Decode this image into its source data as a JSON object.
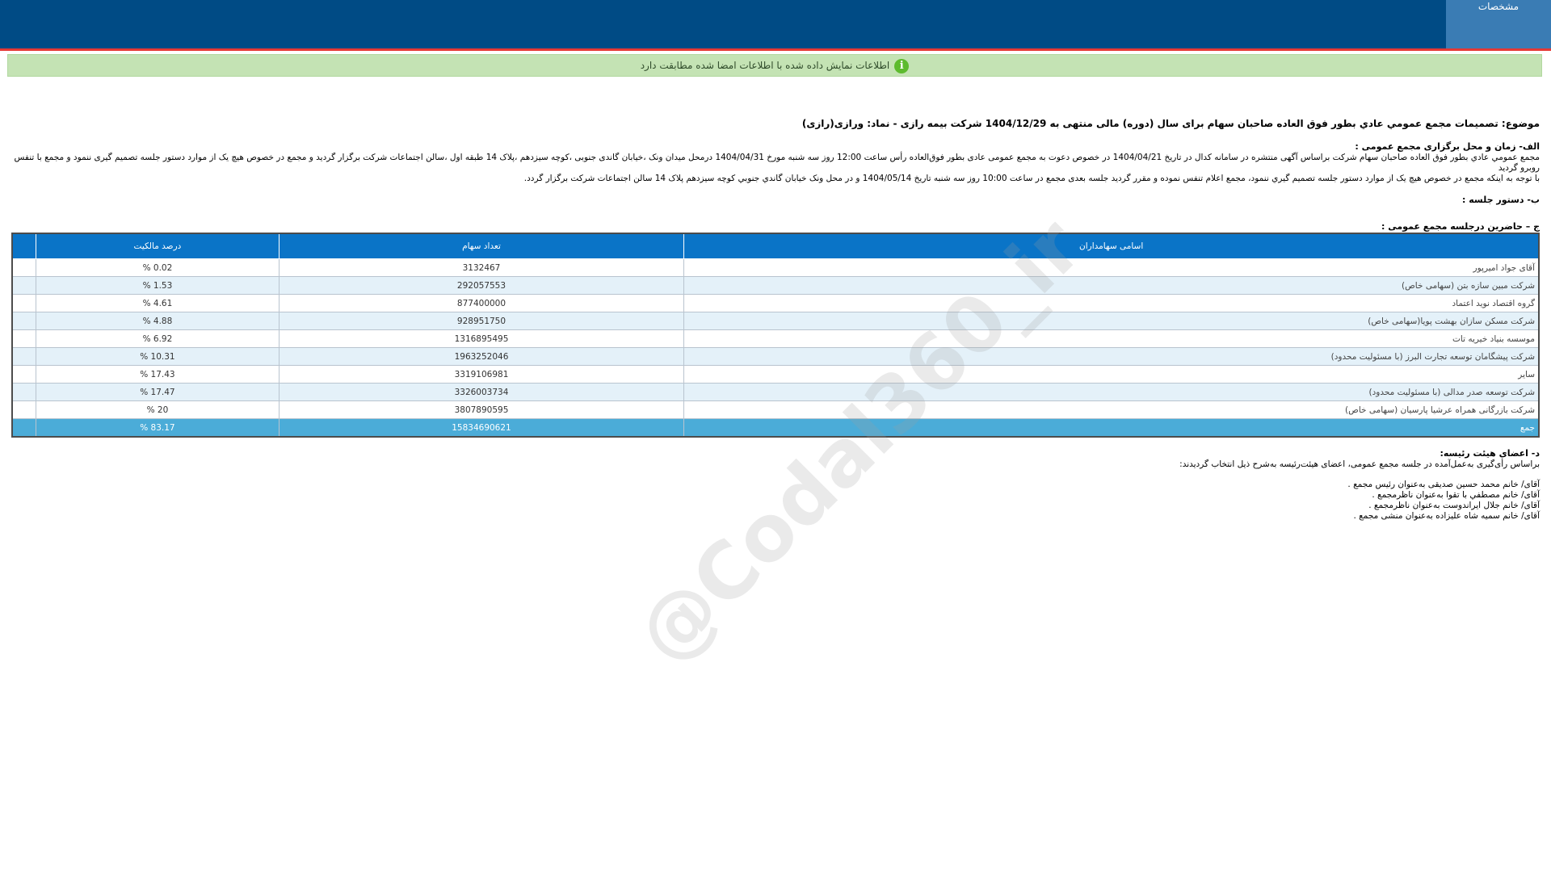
{
  "header": {
    "tab_label": "مشخصات"
  },
  "notice": {
    "text": "اطلاعات نمایش داده شده با اطلاعات امضا شده مطابقت دارد"
  },
  "subject": "موضوع: تصمیمات مجمع عمومي عادي بطور فوق العاده صاحبان سهام برای سال (دوره) مالی منتهی به 1404/12/29 شرکت بیمه رازی - نماد: ورازی(رازی)",
  "section_a": {
    "title": "الف- زمان و محل برگزاری مجمع عمومی :",
    "line1": "مجمع عمومي عادي بطور فوق العاده صاحبان سهام شرکت براساس آگهی منتشره در سامانه کدال در تاریخ 1404/04/21 در خصوص دعوت به مجمع عمومی عادی بطور فوق‌العاده رأس ساعت 12:00 روز سه شنبه مورخ 1404/04/31 درمحل  میدان ونک ،خیابان گاندی جنوبی ،کوچه سیزدهم ،پلاک 14 طبقه اول ،سالن اجتماعات شرکت   برگزار گردید و مجمع در خصوص هیچ یک از موارد دستور جلسه تصمیم گیری ننمود و مجمع با تنفس روبرو گردید",
    "line2": "با توجه به اینکه مجمع در خصوص هیچ یک از موارد دستور جلسه تصمیم گیري ننمود، مجمع اعلام تنفس نموده و مقرر گردید جلسه بعدی مجمع در ساعت 10:00 روز سه شنبه تاریخ 1404/05/14 و در محل ونک خیابان گاندي جنوبي کوچه سیزدهم پلاک 14 سالن اجتماعات شرکت برگزار گردد."
  },
  "section_b": {
    "title": "ب- دستور جلسه :"
  },
  "section_c": {
    "title": "ج – حاضرین درجلسه مجمع عمومی :"
  },
  "table": {
    "headers": {
      "name": "اسامی سهامداران",
      "shares": "تعداد سهام",
      "percent": "درصد مالکیت"
    },
    "rows": [
      {
        "name": "آقای جواد امیرپور",
        "shares": "3132467",
        "percent": "0.02 %"
      },
      {
        "name": "شرکت مبین سازه بتن (سهامی خاص)",
        "shares": "292057553",
        "percent": "1.53 %"
      },
      {
        "name": "گروه اقتصاد نوید اعتماد",
        "shares": "877400000",
        "percent": "4.61 %"
      },
      {
        "name": "شرکت مسکن سازان بهشت پویا(سهامی خاص)",
        "shares": "928951750",
        "percent": "4.88 %"
      },
      {
        "name": "موسسه بنیاد خیریه تات",
        "shares": "1316895495",
        "percent": "6.92 %"
      },
      {
        "name": "شرکت پیشگامان توسعه تجارت البرز (با مسئولیت محدود)",
        "shares": "1963252046",
        "percent": "10.31 %"
      },
      {
        "name": "سایر",
        "shares": "3319106981",
        "percent": "17.43 %"
      },
      {
        "name": "شرکت توسعه صدر مدالی (با مسئولیت محدود)",
        "shares": "3326003734",
        "percent": "17.47 %"
      },
      {
        "name": "شرکت بازرگانی همراه عرشیا پارسیان (سهامی خاص)",
        "shares": "3807890595",
        "percent": "20 %"
      }
    ],
    "total": {
      "name": "جمع",
      "shares": "15834690621",
      "percent": "83.17 %"
    }
  },
  "section_d": {
    "title": "د- اعضای هیئت رئیسه:",
    "intro": "براساس رأی‌گیری به‌عمل‌آمده در جلسه مجمع عمومی، اعضای هیئت‌رئیسه به‌شرح ذیل انتخاب گردیدند:",
    "members": [
      "آقای/ خانم  محمد حسین صدیقی  به‌عنوان رئیس مجمع .",
      "آقای/ خانم  مصطفي با تقوا  به‌عنوان ناظرمجمع .",
      "آقای/ خانم  جلال ایراندوست  به‌عنوان ناظرمجمع .",
      "آقای/ خانم  سمیه شاه علیزاده  به‌عنوان منشی مجمع ."
    ]
  },
  "watermark": "@Codal360_ir"
}
